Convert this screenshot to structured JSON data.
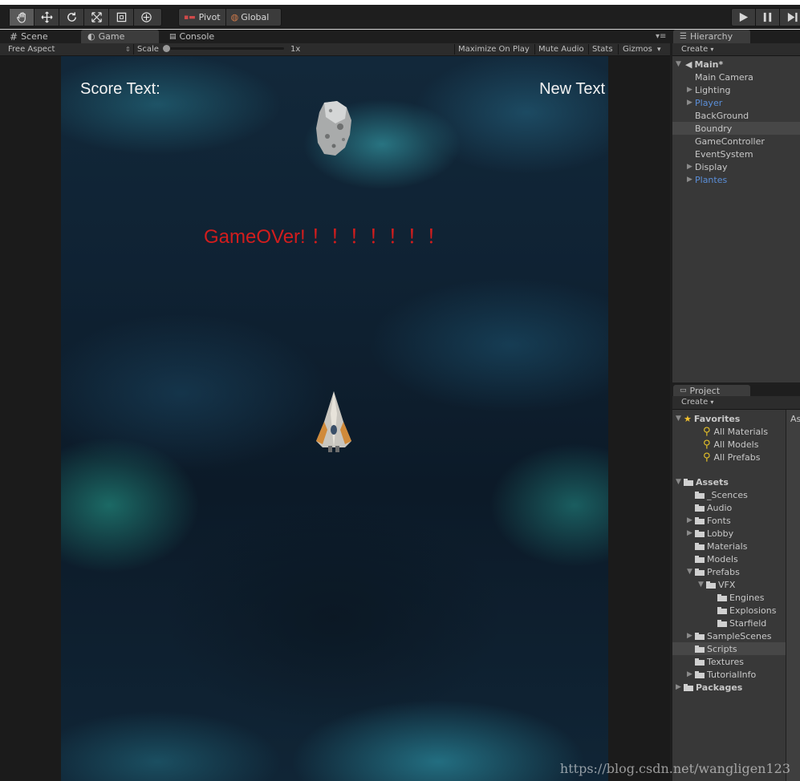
{
  "toolbar": {
    "tools": [
      "hand-tool-icon",
      "move-tool-icon",
      "rotate-tool-icon",
      "scale-tool-icon",
      "rect-tool-icon",
      "transform-tool-icon"
    ],
    "pivot_label": "Pivot",
    "global_label": "Global",
    "play_icons": [
      "play-icon",
      "pause-icon",
      "step-icon"
    ]
  },
  "tabs": {
    "scene": "Scene",
    "game": "Game",
    "console": "Console",
    "hierarchy": "Hierarchy",
    "project": "Project"
  },
  "game_controls": {
    "aspect": "Free Aspect",
    "scale_label": "Scale",
    "scale_value": "1x",
    "maximize": "Maximize On Play",
    "mute": "Mute Audio",
    "stats": "Stats",
    "gizmos": "Gizmos"
  },
  "game": {
    "score_text": "Score Text:",
    "new_text": "New Text",
    "gameover_text": "GameOVer! ！！！！！！！"
  },
  "hierarchy": {
    "create": "Create",
    "scene_name": "Main*",
    "items": [
      {
        "label": "Main Camera",
        "expandable": false,
        "color": "normal"
      },
      {
        "label": "Lighting",
        "expandable": true,
        "color": "normal"
      },
      {
        "label": "Player",
        "expandable": true,
        "color": "blue"
      },
      {
        "label": "BackGround",
        "expandable": false,
        "color": "normal"
      },
      {
        "label": "Boundry",
        "expandable": false,
        "color": "normal",
        "selected": true
      },
      {
        "label": "GameController",
        "expandable": false,
        "color": "normal"
      },
      {
        "label": "EventSystem",
        "expandable": false,
        "color": "normal"
      },
      {
        "label": "Display",
        "expandable": true,
        "color": "normal"
      },
      {
        "label": "Plantes",
        "expandable": true,
        "color": "blue"
      }
    ]
  },
  "project": {
    "create": "Create",
    "favorites_label": "Favorites",
    "favorites": [
      "All Materials",
      "All Models",
      "All Prefabs"
    ],
    "assets_label": "Assets",
    "assets": [
      {
        "label": "_Scences",
        "depth": 1,
        "expandable": false
      },
      {
        "label": "Audio",
        "depth": 1,
        "expandable": false
      },
      {
        "label": "Fonts",
        "depth": 1,
        "expandable": true
      },
      {
        "label": "Lobby",
        "depth": 1,
        "expandable": true
      },
      {
        "label": "Materials",
        "depth": 1,
        "expandable": false
      },
      {
        "label": "Models",
        "depth": 1,
        "expandable": false
      },
      {
        "label": "Prefabs",
        "depth": 1,
        "expandable": true,
        "open": true
      },
      {
        "label": "VFX",
        "depth": 2,
        "expandable": true,
        "open": true
      },
      {
        "label": "Engines",
        "depth": 3,
        "expandable": false
      },
      {
        "label": "Explosions",
        "depth": 3,
        "expandable": false
      },
      {
        "label": "Starfield",
        "depth": 3,
        "expandable": false
      },
      {
        "label": "SampleScenes",
        "depth": 1,
        "expandable": true
      },
      {
        "label": "Scripts",
        "depth": 1,
        "expandable": false,
        "selected": true
      },
      {
        "label": "Textures",
        "depth": 1,
        "expandable": false
      },
      {
        "label": "TutorialInfo",
        "depth": 1,
        "expandable": true
      }
    ],
    "packages_label": "Packages",
    "right_pane_text": "As"
  },
  "watermark": "https://blog.csdn.net/wangligen123"
}
